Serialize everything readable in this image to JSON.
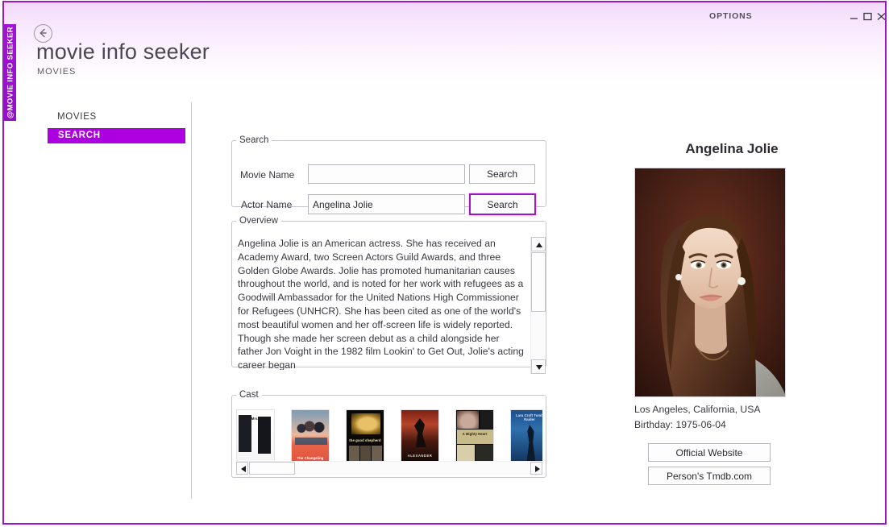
{
  "window": {
    "vertical_tab_label": "@MOVIE INFO SEEKER",
    "options_label": "OPTIONS",
    "minimize_icon": "minimize-icon",
    "maximize_icon": "maximize-icon",
    "close_icon": "close-icon",
    "border_color": "#9b18c4",
    "accent_color": "#ad00e0"
  },
  "header": {
    "back_icon": "back-arrow-icon",
    "title": "movie info seeker",
    "subtitle": "MOVIES"
  },
  "sidebar": {
    "heading": "MOVIES",
    "items": [
      {
        "label": "SEARCH",
        "active": true
      }
    ]
  },
  "search": {
    "legend": "Search",
    "movie_name_label": "Movie Name",
    "movie_name_value": "",
    "movie_name_placeholder": "",
    "movie_search_button": "Search",
    "actor_name_label": "Actor Name",
    "actor_name_value": "Angelina Jolie",
    "actor_name_placeholder": "",
    "actor_search_button": "Search",
    "focused_button": "actor-search"
  },
  "overview": {
    "legend": "Overview",
    "text": "Angelina Jolie is an American actress. She has received an Academy Award, two Screen Actors Guild Awards, and three Golden Globe Awards. Jolie has promoted humanitarian causes throughout the world, and is noted for her work with refugees as a Goodwill Ambassador for the United Nations High Commissioner for Refugees (UNHCR). She has been cited as one of the world's most beautiful women and her off-screen life is widely reported. Though she made her screen debut as a child alongside her father Jon Voight in the 1982 film Lookin' to Get Out, Jolie's acting career began",
    "scroll_up_icon": "triangle-up-icon",
    "scroll_down_icon": "triangle-down-icon"
  },
  "cast": {
    "legend": "Cast",
    "scroll_left_icon": "triangle-left-icon",
    "scroll_right_icon": "triangle-right-icon",
    "posters": [
      {
        "title": "Mr. & Mrs. Smith"
      },
      {
        "title": "The Changeling"
      },
      {
        "title": "the good shepherd"
      },
      {
        "title": "ALEXANDER"
      },
      {
        "title": "A Mighty Heart"
      },
      {
        "title": "Lara Croft Tomb Raider"
      }
    ]
  },
  "detail": {
    "person_name": "Angelina Jolie",
    "photo_alt": "angelina-jolie-portrait",
    "birthplace": "Los Angeles, California, USA",
    "birthday": "Birthday: 1975-06-04",
    "official_website_button": "Official Website",
    "tmdb_button": "Person's Tmdb.com"
  }
}
